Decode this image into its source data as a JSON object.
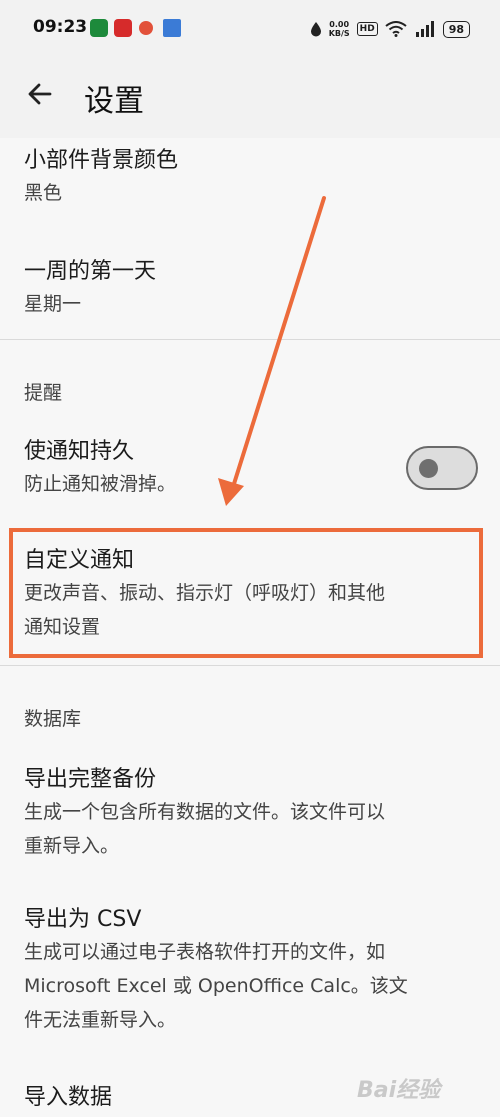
{
  "status_bar": {
    "time": "09:23",
    "net_speed": "0.00",
    "net_unit": "KB/S",
    "hd": "HD",
    "battery": "98"
  },
  "header": {
    "back_icon": "arrow-left",
    "title": "设置"
  },
  "settings": {
    "widget_bg": {
      "title": "小部件背景颜色",
      "value": "黑色"
    },
    "first_day": {
      "title": "一周的第一天",
      "value": "星期一"
    },
    "reminder_section": "提醒",
    "persistent": {
      "title": "使通知持久",
      "subtitle": "防止通知被滑掉。",
      "enabled": false
    },
    "custom_notify": {
      "title": "自定义通知",
      "subtitle_line1": "更改声音、振动、指示灯（呼吸灯）和其他",
      "subtitle_line2": "通知设置"
    },
    "database_section": "数据库",
    "export_backup": {
      "title": "导出完整备份",
      "subtitle_line1": "生成一个包含所有数据的文件。该文件可以",
      "subtitle_line2": "重新导入。"
    },
    "export_csv": {
      "title": "导出为 CSV",
      "subtitle_line1": "生成可以通过电子表格软件打开的文件，如",
      "subtitle_line2": "Microsoft Excel 或 OpenOffice Calc。该文",
      "subtitle_line3": "件无法重新导入。"
    },
    "import": {
      "title": "导入数据"
    }
  },
  "annotation": {
    "color": "#ec6b3b"
  },
  "watermark": "Bai经验"
}
